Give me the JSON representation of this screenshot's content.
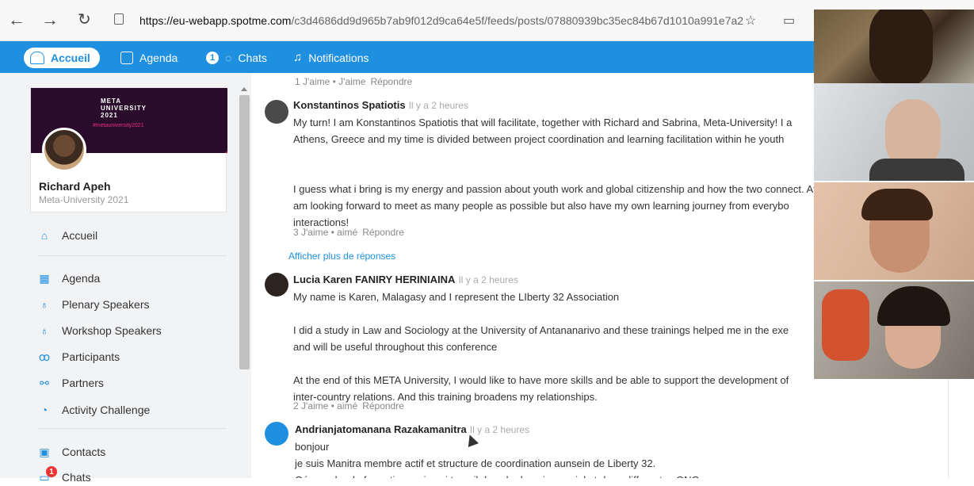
{
  "browser": {
    "url_host": "https://eu-webapp.spotme.com",
    "url_path": "/c3d4686dd9d965b7ab9f012d9ca64e5f/feeds/posts/07880939bc35ec84b67d1010a991e7a2"
  },
  "appbar": {
    "tabs": [
      {
        "label": "Accueil",
        "icon": "home-icon",
        "active": true
      },
      {
        "label": "Agenda",
        "icon": "calendar-icon"
      },
      {
        "label": "Chats",
        "icon": "chat-icon",
        "badge": "1"
      },
      {
        "label": "Notifications",
        "icon": "bell-icon"
      }
    ]
  },
  "profile": {
    "cover_logo": "META\nUNIVERSITY\n2021",
    "cover_tag": "#metauniversity2021",
    "name": "Richard Apeh",
    "subtitle": "Meta-University 2021"
  },
  "sidebar": {
    "items": [
      {
        "label": "Accueil",
        "icon": "home-icon"
      },
      {
        "label": "Agenda",
        "icon": "calendar-icon"
      },
      {
        "label": "Plenary Speakers",
        "icon": "microphone-icon"
      },
      {
        "label": "Workshop Speakers",
        "icon": "microphone-icon"
      },
      {
        "label": "Participants",
        "icon": "people-icon"
      },
      {
        "label": "Partners",
        "icon": "handshake-icon"
      },
      {
        "label": "Activity Challenge",
        "icon": "gauge-icon"
      },
      {
        "label": "Contacts",
        "icon": "contact-card-icon"
      },
      {
        "label": "Chats",
        "icon": "chat-icon",
        "badge": "1"
      }
    ]
  },
  "feed": {
    "top_meta": {
      "likes": "1 J'aime • J'aime",
      "reply": "Répondre"
    },
    "comments": [
      {
        "author": "Konstantinos Spatiotis",
        "time": "Il y a 2 heures",
        "lines": [
          "My turn! I am Konstantinos Spatiotis that will facilitate, together with Richard and Sabrina, Meta-University! I a",
          "Athens, Greece and my time is divided between project coordination and learning facilitation within he youth",
          "",
          "",
          "I guess what i bring is my energy and passion about youth work and global citizenship and how the two connect. At the same time I",
          "am looking forward to meet as many people as possible but also have my own learning journey from everybo",
          "interactions!"
        ],
        "likes": "3 J'aime • aimé",
        "reply": "Répondre"
      },
      {
        "author": "Lucia Karen FANIRY HERINIAINA",
        "time": "Il y a 2 heures",
        "lines": [
          "My name is Karen, Malagasy and I represent the LIberty 32 Association",
          "",
          "I did a study in Law and Sociology at the University of Antananarivo and these trainings helped me in the exe",
          "and will be useful throughout this conference",
          "",
          "At the end of this META University, I would like to have more skills and be able to support the development of",
          "inter-country relations. And this training broadens my relationships."
        ],
        "likes": "2 J'aime • aimé",
        "reply": "Répondre"
      },
      {
        "author": "Andrianjatomanana Razakamanitra",
        "time": "Il y a 2 heures",
        "lines": [
          "bonjour",
          "je suis Manitra membre actif et structure de coordination aunsein de Liberty 32.",
          "Géographe de formation mais qui travail dans le domaine social et dans differentes ONG"
        ]
      }
    ],
    "more_replies": "Afficher plus de réponses"
  },
  "colors": {
    "accent": "#1f8fe0",
    "sidebar_bg": "#f2f3f5",
    "badge_red": "#e33333"
  }
}
